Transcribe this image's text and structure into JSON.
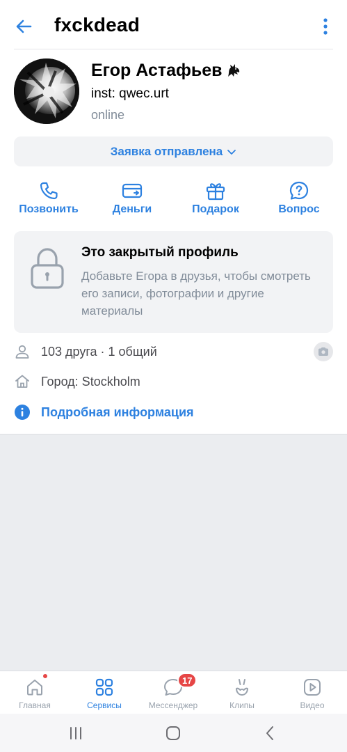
{
  "header": {
    "title": "fxckdead"
  },
  "profile": {
    "name": "Егор Астафьев",
    "status": "inst: qwec.urt",
    "presence": "online",
    "request_label": "Заявка отправлена"
  },
  "actions": [
    {
      "label": "Позвонить",
      "icon": "phone-icon"
    },
    {
      "label": "Деньги",
      "icon": "money-icon"
    },
    {
      "label": "Подарок",
      "icon": "gift-icon"
    },
    {
      "label": "Вопрос",
      "icon": "question-icon"
    }
  ],
  "private_notice": {
    "title": "Это закрытый профиль",
    "text": "Добавьте Егора в друзья, чтобы смотреть его записи, фотографии и другие материалы"
  },
  "info": {
    "friends": "103 друга · 1 общий",
    "city": "Город: Stockholm",
    "details_link": "Подробная информация"
  },
  "tabbar": {
    "tabs": [
      {
        "label": "Главная",
        "icon": "home-icon"
      },
      {
        "label": "Сервисы",
        "icon": "services-icon"
      },
      {
        "label": "Мессенджер",
        "icon": "messenger-icon",
        "badge": "17"
      },
      {
        "label": "Клипы",
        "icon": "clips-icon"
      },
      {
        "label": "Видео",
        "icon": "video-icon"
      }
    ],
    "active_tab": "Сервисы"
  },
  "colors": {
    "accent": "#2d81e0",
    "secondary_text": "#818c99",
    "badge": "#e64646",
    "card_bg": "#f2f3f5"
  }
}
